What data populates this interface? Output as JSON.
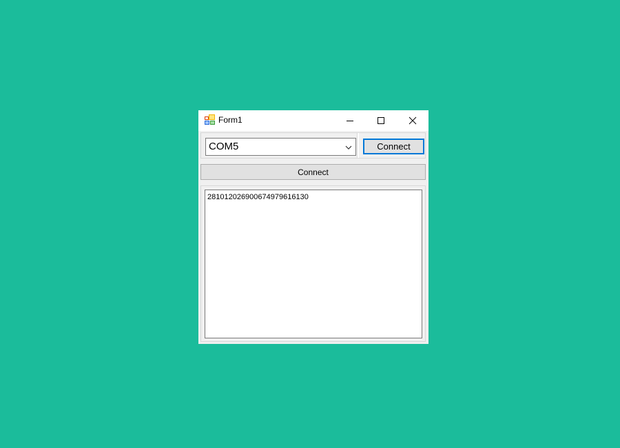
{
  "window": {
    "title": "Form1"
  },
  "titlebar": {
    "icons": [
      "app-icon",
      "minimize-icon",
      "maximize-icon",
      "close-icon"
    ]
  },
  "port_select": {
    "value": "COM5"
  },
  "toolbar": {
    "connect_label": "Connect"
  },
  "connect_bar": {
    "label": "Connect"
  },
  "output": {
    "text": "28101202690067497961613​0"
  },
  "colors": {
    "desktop": "#1bbc9b",
    "window_bg": "#f0f0f0",
    "focus_border": "#0078d7"
  }
}
